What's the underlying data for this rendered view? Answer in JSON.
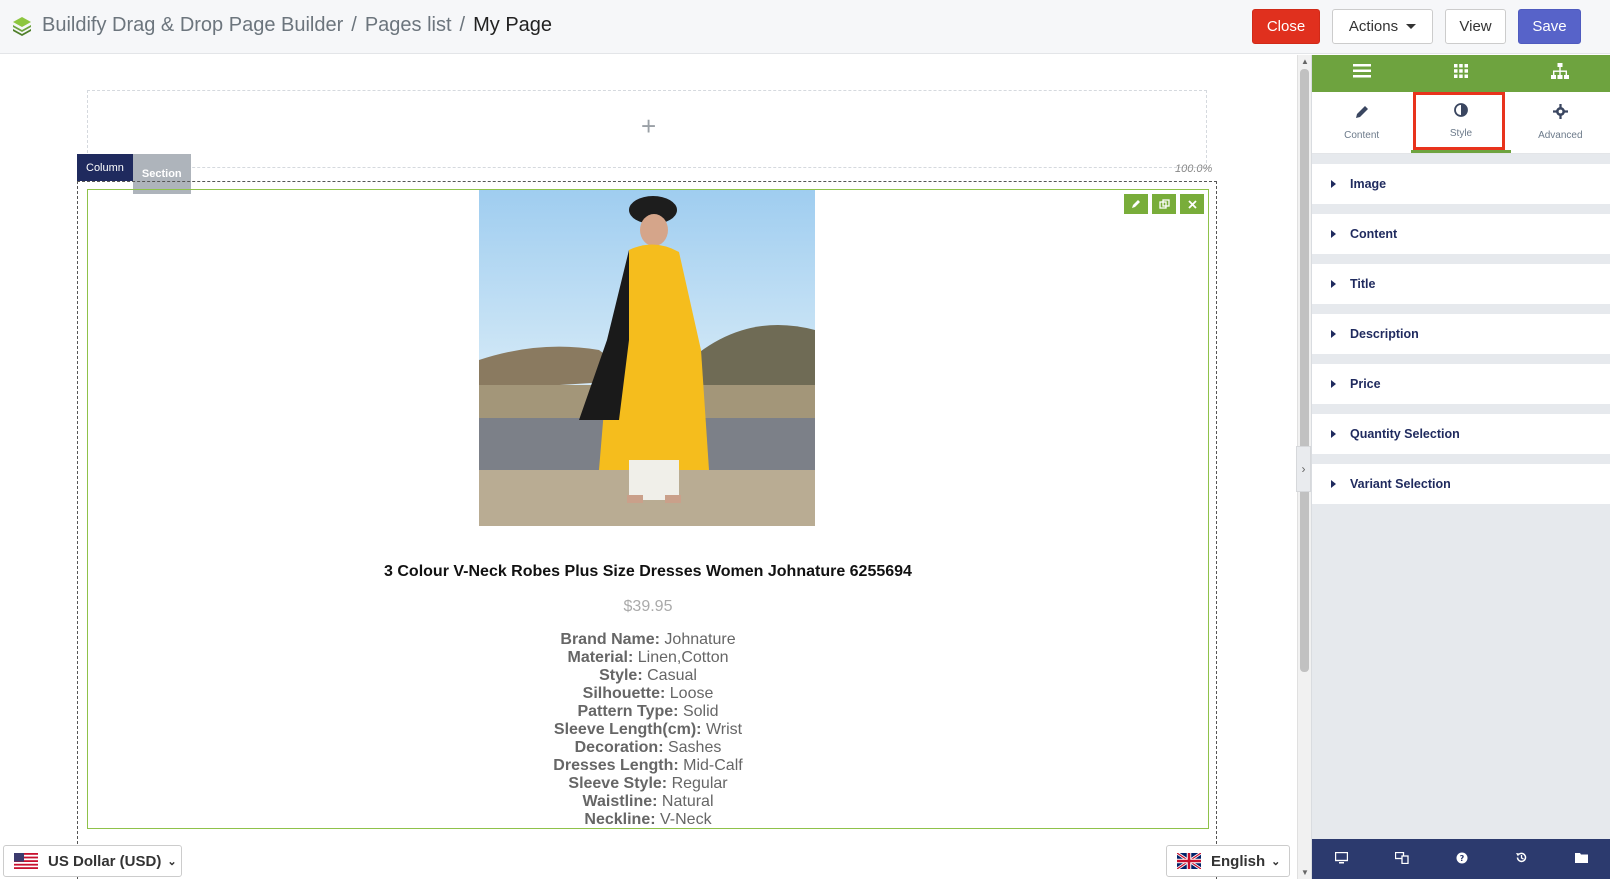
{
  "header": {
    "breadcrumb": [
      "Buildify Drag & Drop Page Builder",
      "Pages list",
      "My Page"
    ],
    "separator": "/",
    "buttons": {
      "close": "Close",
      "actions": "Actions",
      "view": "View",
      "save": "Save"
    },
    "colors": {
      "close": "#e0301e",
      "save": "#5763c9"
    }
  },
  "canvas": {
    "add_icon": "+",
    "width_label": "100.0%",
    "tabs": {
      "column": "Column",
      "section": "Section"
    },
    "widget_tools": [
      "edit-icon",
      "duplicate-icon",
      "delete-icon"
    ],
    "product": {
      "title": "3 Colour V-Neck Robes Plus Size Dresses Women Johnature 6255694",
      "price": "$39.95",
      "specs": [
        {
          "k": "Brand Name:",
          "v": "Johnature"
        },
        {
          "k": "Material:",
          "v": "Linen,Cotton"
        },
        {
          "k": "Style:",
          "v": "Casual"
        },
        {
          "k": "Silhouette:",
          "v": "Loose"
        },
        {
          "k": "Pattern Type:",
          "v": "Solid"
        },
        {
          "k": "Sleeve Length(cm):",
          "v": "Wrist"
        },
        {
          "k": "Decoration:",
          "v": "Sashes"
        },
        {
          "k": "Dresses Length:",
          "v": "Mid-Calf"
        },
        {
          "k": "Sleeve Style:",
          "v": "Regular"
        },
        {
          "k": "Waistline:",
          "v": "Natural"
        },
        {
          "k": "Neckline:",
          "v": "V-Neck"
        }
      ]
    }
  },
  "panel": {
    "top_icons": [
      "menu-icon",
      "grid-icon",
      "sitemap-icon"
    ],
    "tabs": [
      {
        "label": "Content",
        "icon": "pencil-icon"
      },
      {
        "label": "Style",
        "icon": "contrast-icon",
        "active": true
      },
      {
        "label": "Advanced",
        "icon": "gear-icon"
      }
    ],
    "sections": [
      "Image",
      "Content",
      "Title",
      "Description",
      "Price",
      "Quantity Selection",
      "Variant Selection"
    ],
    "bottom_icons": [
      "desktop-icon",
      "responsive-icon",
      "help-icon",
      "history-icon",
      "folder-icon"
    ],
    "colors": {
      "green": "#6ea33f",
      "navy": "#2c3a6e",
      "highlight": "#e8331c"
    }
  },
  "footer": {
    "currency": "US Dollar (USD)",
    "language": "English"
  }
}
